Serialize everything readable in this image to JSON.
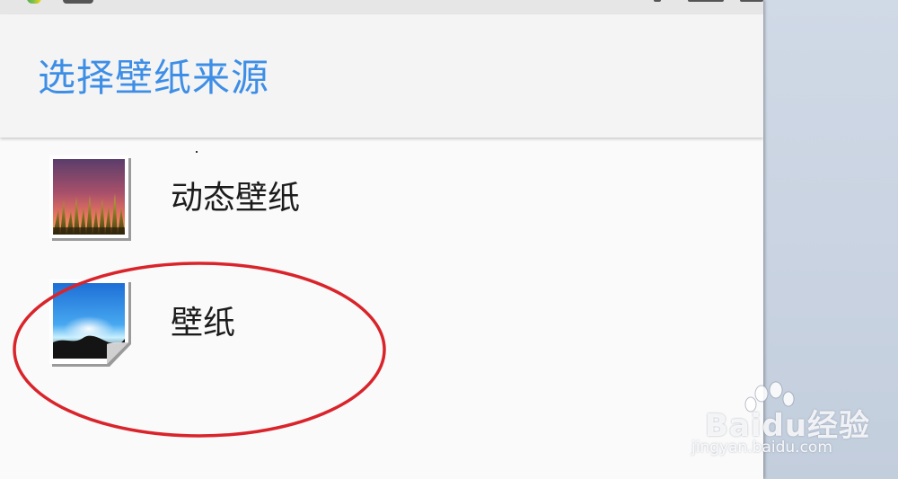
{
  "dialog": {
    "title": "选择壁纸来源"
  },
  "items": [
    {
      "label": "动态壁纸",
      "icon": "live-wallpaper-icon"
    },
    {
      "label": "壁纸",
      "icon": "gallery-wallpaper-icon"
    }
  ],
  "annotation": {
    "color": "#d9242b"
  },
  "watermark": {
    "brand": "Baidu经验",
    "url": "jingyan.baidu.com"
  },
  "colors": {
    "title_blue": "#3d8ee6",
    "header_bg": "#f4f4f4",
    "list_bg": "#fafafa"
  }
}
